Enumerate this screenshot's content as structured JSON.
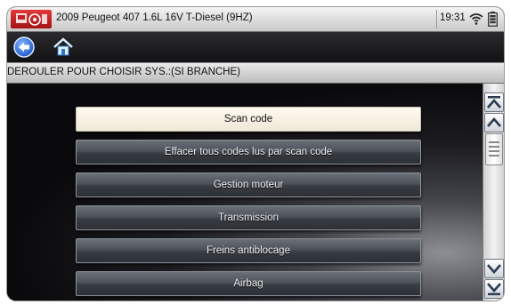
{
  "titlebar": {
    "title": "2009 Peugeot 407 1.6L 16V T-Diesel  (9HZ)",
    "time": "19:31",
    "icons": [
      "vehicle-logo-icon",
      "wifi-icon",
      "battery-icon"
    ]
  },
  "toolbar": {
    "icons": [
      "back-icon",
      "home-icon"
    ]
  },
  "instruction": "DEROULER POUR CHOISIR SYS.:(SI BRANCHE)",
  "menu": {
    "items": [
      {
        "label": "Scan code",
        "selected": true
      },
      {
        "label": "Effacer tous codes lus par scan code",
        "selected": false
      },
      {
        "label": "Gestion moteur",
        "selected": false
      },
      {
        "label": "Transmission",
        "selected": false
      },
      {
        "label": "Freins antiblocage",
        "selected": false
      },
      {
        "label": "Airbag",
        "selected": false
      }
    ]
  },
  "scrollbar": {
    "icons": [
      "page-up-icon",
      "line-up-icon",
      "line-down-icon",
      "page-down-icon"
    ]
  },
  "colors": {
    "screen_bg": "#060608",
    "selected_item_bg": "#fffaf0",
    "item_bg": "#4d525a",
    "logo_red": "#c42222"
  }
}
